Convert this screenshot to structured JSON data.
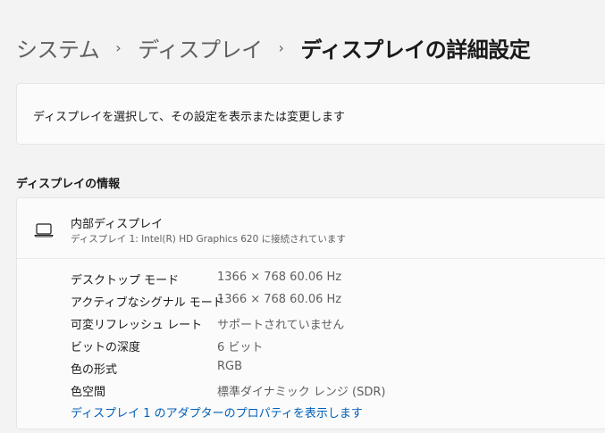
{
  "breadcrumb": {
    "items": [
      "システム",
      "ディスプレイ"
    ],
    "separator": "›",
    "current": "ディスプレイの詳細設定"
  },
  "select_card": {
    "text": "ディスプレイを選択して、その設定を表示または変更します"
  },
  "display_info": {
    "section_title": "ディスプレイの情報",
    "icon": "laptop-icon",
    "name": "内部ディスプレイ",
    "subtitle": "ディスプレイ 1: Intel(R) HD Graphics 620 に接続されています",
    "properties": [
      {
        "label": "デスクトップ モード",
        "value": "1366 × 768 60.06 Hz"
      },
      {
        "label": "アクティブなシグナル モード",
        "value": "1366 × 768 60.06 Hz"
      },
      {
        "label": "可変リフレッシュ レート",
        "value": "サポートされていません"
      },
      {
        "label": "ビットの深度",
        "value": "6 ビット"
      },
      {
        "label": "色の形式",
        "value": "RGB"
      },
      {
        "label": "色空間",
        "value": "標準ダイナミック レンジ (SDR)"
      }
    ],
    "adapter_link": "ディスプレイ 1 のアダプターのプロパティを表示します"
  },
  "colors": {
    "background": "#f3f3f3",
    "card": "#fbfbfb",
    "link": "#005fb8",
    "secondary_text": "#5f5f5f"
  }
}
